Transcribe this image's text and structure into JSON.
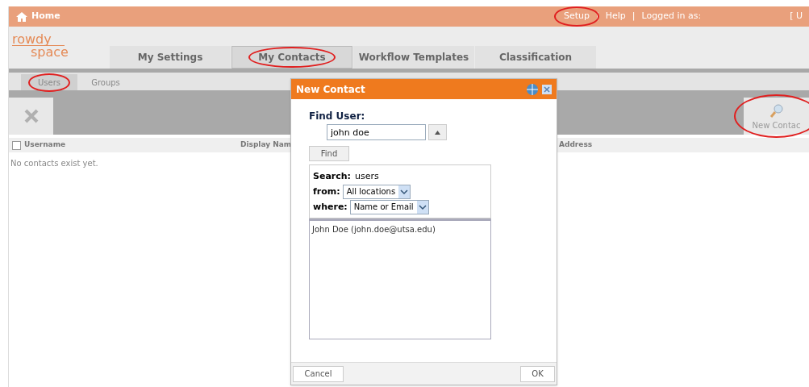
{
  "top_bar": {
    "home": "Home",
    "links": [
      {
        "label": "Setup",
        "annotated": true
      },
      {
        "label": "Help",
        "annotated": false
      }
    ],
    "separator": "|",
    "logged_in": "Logged in as:",
    "user": "[ U"
  },
  "logo": {
    "line1": "rowdy",
    "line2": "space"
  },
  "tabs": [
    {
      "label": "My Settings",
      "selected": false,
      "annotated": false
    },
    {
      "label": "My Contacts",
      "selected": true,
      "annotated": true
    },
    {
      "label": "Workflow Templates",
      "selected": false,
      "annotated": false
    },
    {
      "label": "Classification",
      "selected": false,
      "annotated": false
    }
  ],
  "sub_tabs": [
    {
      "label": "Users",
      "selected": true,
      "annotated": true
    },
    {
      "label": "Groups",
      "selected": false,
      "annotated": false
    }
  ],
  "toolbar": {
    "new_contact": {
      "label": "New Contac",
      "annotated": true
    }
  },
  "table": {
    "columns": [
      "Username",
      "Display Nam",
      "Address"
    ],
    "select_all_checked": false,
    "empty_message": "No contacts exist yet."
  },
  "dialog": {
    "title": "New Contact",
    "find_user_label": "Find User:",
    "find_user_value": "john doe",
    "find_button": "Find",
    "search_label": "Search:",
    "search_value": "users",
    "from_label": "from:",
    "from_value": "All locations",
    "where_label": "where:",
    "where_value": "Name or Email",
    "results": [
      "John Doe (john.doe@utsa.edu)"
    ],
    "cancel": "Cancel",
    "ok": "OK"
  }
}
